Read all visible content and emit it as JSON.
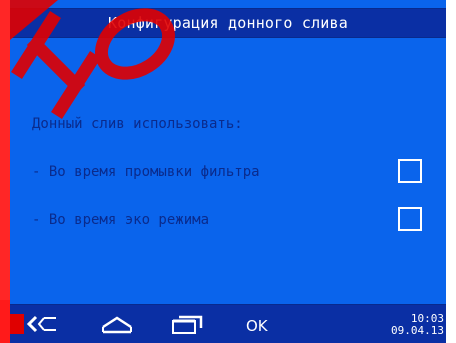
{
  "header": {
    "title": "Конфигурация донного слива"
  },
  "content": {
    "section_label": "Донный слив использовать:",
    "options": [
      {
        "label": "- Во время промывки фильтра",
        "checked": false
      },
      {
        "label": "- Во время эко режима",
        "checked": false
      }
    ]
  },
  "footer": {
    "back_icon": "back-arrow-icon",
    "home_icon": "home-icon",
    "windows_icon": "windows-icon",
    "ok_label": "OK",
    "time": "10:03",
    "date": "09.04.13"
  },
  "colors": {
    "screen_bg": "#0a64ec",
    "bar_bg": "#0a2fa4",
    "text_dark": "#0a2b8c",
    "text_light": "#ffffff",
    "watermark": "#ff0000"
  }
}
